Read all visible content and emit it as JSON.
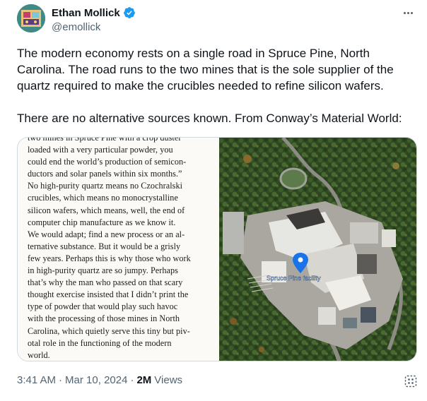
{
  "author": {
    "display_name": "Ethan Mollick",
    "handle": "@emollick",
    "verified": true
  },
  "tweet": {
    "paragraph_1": "The modern economy rests on a single road in Spruce Pine, North Carolina. The road runs to the two mines that is the sole supplier of the quartz required to make the crucibles needed to refine silicon wafers.",
    "paragraph_2": "There are no alternative sources known. From Conway’s Material World:"
  },
  "media": {
    "book_excerpt": "two mines in Spruce Pine with a crop duster\nloaded with a very particular powder, you\ncould end the world’s production of semicon-\nductors and solar panels within six months.”\nNo high-purity quartz means no Czochralski\ncrucibles, which means no monocrystalline\nsilicon wafers, which means, well, the end of\ncomputer chip manufacture as we know it.\nWe would adapt; find a new process or an al-\nternative substance. But it would be a grisly\nfew years. Perhaps this is why those who work\nin high-purity quartz are so jumpy. Perhaps\nthat’s why the man who passed on that scary\nthought exercise insisted that I didn’t print the\ntype of powder that would play such havoc\nwith the processing of those mines in North\nCarolina, which quietly serve this tiny but piv-\notal role in the functioning of the modern\nworld.",
    "map_label": "Spruce Pine facility"
  },
  "meta": {
    "time": "3:41 AM",
    "date": "Mar 10, 2024",
    "separator": "·",
    "views_count": "2M",
    "views_label": "Views"
  },
  "icons": [
    "avatar",
    "verified-badge-icon",
    "more-options-icon",
    "map-pin-icon",
    "analytics-icon"
  ],
  "colors": {
    "text_primary": "#0f1419",
    "text_secondary": "#536471",
    "verified_blue": "#1d9bf0",
    "border": "#cfd9de"
  }
}
